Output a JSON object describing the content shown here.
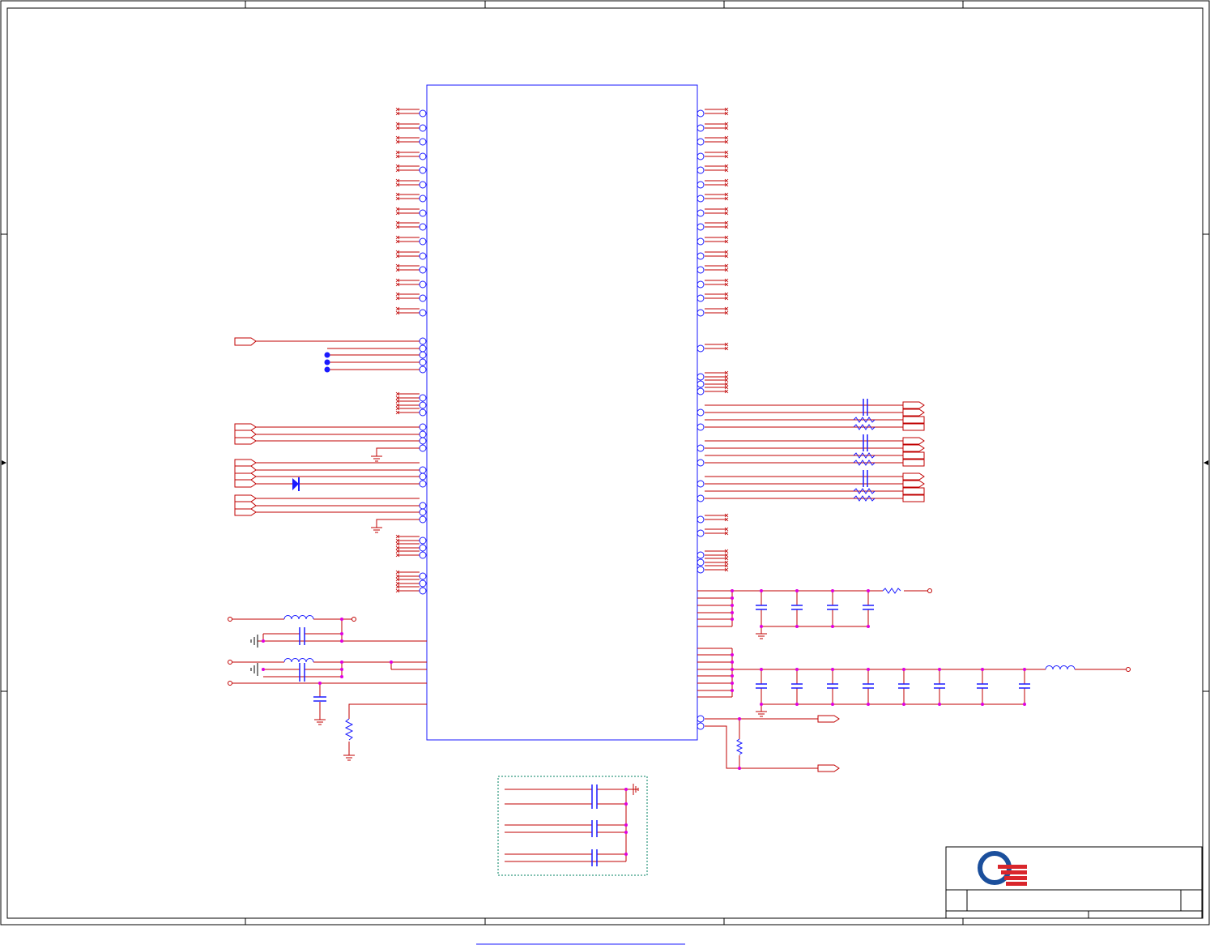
{
  "diagram": {
    "type": "schematic",
    "title_block": {
      "logo": "company-logo",
      "title": "",
      "rev": "",
      "sheet": ""
    },
    "colors": {
      "frame": "#000000",
      "component": "#1a1aff",
      "wire": "#c00000",
      "junction": "#e000e0",
      "group_outline": "#008060",
      "logo_blue": "#1b4f9c",
      "logo_red": "#d9262c"
    },
    "icons": [
      "ground-symbol",
      "no-connect-marker",
      "off-page-connector",
      "diode",
      "inductor",
      "capacitor",
      "resistor",
      "pin-bubble"
    ]
  }
}
